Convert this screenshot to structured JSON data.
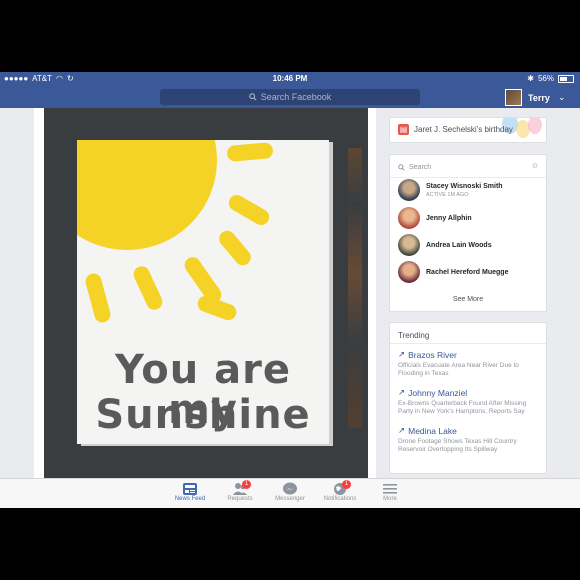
{
  "status_bar": {
    "carrier": "AT&T",
    "time": "10:46 PM",
    "battery": "56%",
    "battery_level": 0.56
  },
  "nav": {
    "search_placeholder": "Search Facebook",
    "user_name": "Terry"
  },
  "photo": {
    "line1": "You are my",
    "line2": "Sunshine"
  },
  "birthday": {
    "name": "Jaret J. Sechelski",
    "suffix": "'s birthday"
  },
  "chat": {
    "search_placeholder": "Search",
    "friends": [
      {
        "name": "Stacey Wisnoski Smith",
        "status": "ACTIVE 1M AGO"
      },
      {
        "name": "Jenny Allphin",
        "status": ""
      },
      {
        "name": "Andrea Lain Woods",
        "status": ""
      },
      {
        "name": "Rachel Hereford Muegge",
        "status": ""
      }
    ],
    "see_more": "See More"
  },
  "trending": {
    "header": "Trending",
    "items": [
      {
        "topic": "Brazos River",
        "desc": "Officials Evacuate Area Near River Due to Flooding in Texas"
      },
      {
        "topic": "Johnny Manziel",
        "desc": "Ex-Browns Quarterback Found After Missing Party in New York's Hamptons, Reports Say"
      },
      {
        "topic": "Medina Lake",
        "desc": "Drone Footage Shows Texas Hill Country Reservoir Overtopping Its Spillway"
      }
    ]
  },
  "tabs": [
    {
      "label": "News Feed",
      "badge": ""
    },
    {
      "label": "Requests",
      "badge": "1"
    },
    {
      "label": "Messenger",
      "badge": ""
    },
    {
      "label": "Notifications",
      "badge": "1"
    },
    {
      "label": "More",
      "badge": ""
    }
  ],
  "colors": {
    "brand": "#3b5998",
    "sun_yellow": "#f5d226",
    "badge": "#fa3e3e",
    "link": "#365899"
  }
}
